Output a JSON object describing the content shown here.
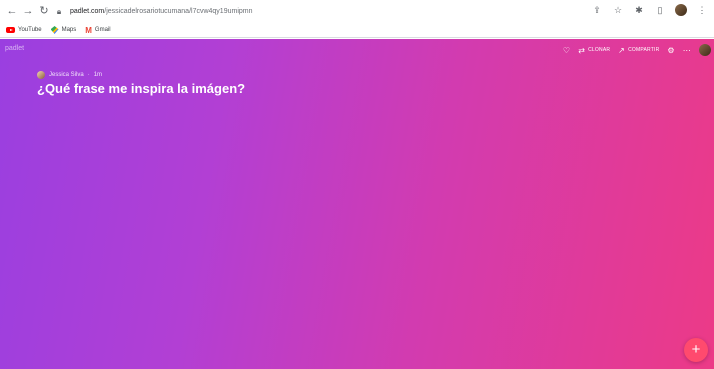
{
  "browser": {
    "url_host": "padlet.com",
    "url_path": "/jessicadelrosariotucumana/l7cvw4qy19umipmn",
    "icons": [
      "arrow-left-icon",
      "arrow-right-icon",
      "reload-icon",
      "lock-icon",
      "share-icon",
      "star-icon",
      "extensions-icon",
      "sidepanel-icon",
      "profile-avatar",
      "kebab-menu-icon"
    ]
  },
  "bookmarks": [
    {
      "label": "YouTube",
      "icon": "youtube-icon"
    },
    {
      "label": "Maps",
      "icon": "maps-icon"
    },
    {
      "label": "Gmail",
      "icon": "gmail-icon"
    }
  ],
  "board": {
    "logo": "padlet",
    "actions": {
      "like_icon": "heart-icon",
      "clone_label": "CLONAR",
      "share_label": "COMPARTIR",
      "settings_icon": "gear-icon",
      "more_icon": "ellipsis-icon"
    },
    "author": "Jessica Silva",
    "time": "1m",
    "title": "¿Qué frase me inspira la imágen?",
    "fab_label": "+",
    "colors": {
      "gradient_start": "#9a3fe0",
      "gradient_end": "#ec3a87",
      "fab": "#ff4a6e"
    }
  }
}
